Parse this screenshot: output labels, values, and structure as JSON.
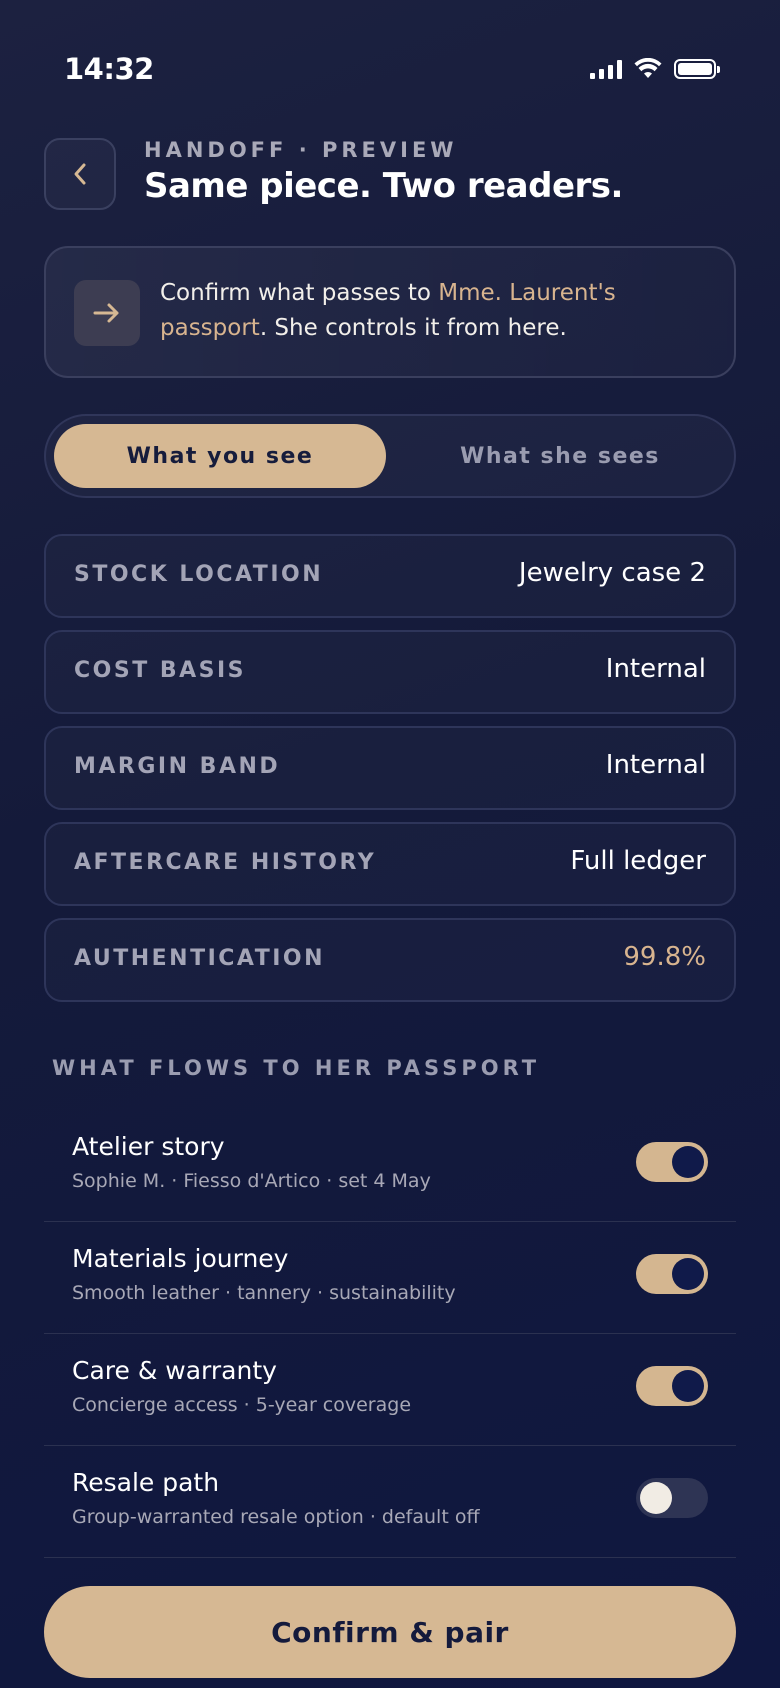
{
  "status_bar": {
    "time": "14:32",
    "signal_icon": "cellular-signal-icon",
    "wifi_icon": "wifi-icon",
    "battery_icon": "battery-icon"
  },
  "header": {
    "back_icon": "chevron-left-icon",
    "eyebrow": "HANDOFF · PREVIEW",
    "title": "Same piece. Two readers."
  },
  "notice": {
    "icon": "arrow-right-icon",
    "text_before": "Confirm what passes to ",
    "highlight": "Mme. Laurent's passport",
    "text_after": ". She controls it from here."
  },
  "tabs": {
    "active": "What you see",
    "inactive": "What she sees"
  },
  "fields": [
    {
      "label": "STOCK LOCATION",
      "value": "Jewelry case 2"
    },
    {
      "label": "COST BASIS",
      "value": "Internal"
    },
    {
      "label": "MARGIN BAND",
      "value": "Internal"
    },
    {
      "label": "AFTERCARE HISTORY",
      "value": "Full ledger"
    },
    {
      "label": "AUTHENTICATION",
      "value": "99.8%"
    }
  ],
  "flows": {
    "section_title": "WHAT FLOWS TO HER PASSPORT",
    "items": [
      {
        "title": "Atelier story",
        "subtitle": "Sophie M. · Fiesso d'Artico · set 4 May",
        "enabled": true
      },
      {
        "title": "Materials journey",
        "subtitle": "Smooth leather · tannery · sustainability",
        "enabled": true
      },
      {
        "title": "Care & warranty",
        "subtitle": "Concierge access · 5-year coverage",
        "enabled": true
      },
      {
        "title": "Resale path",
        "subtitle": "Group-warranted resale option · default off",
        "enabled": false
      }
    ]
  },
  "confirm_button": "Confirm & pair",
  "colors": {
    "accent": "#d6b893",
    "background": "#141a3a",
    "toggle_knob_on": "#101a4a"
  }
}
